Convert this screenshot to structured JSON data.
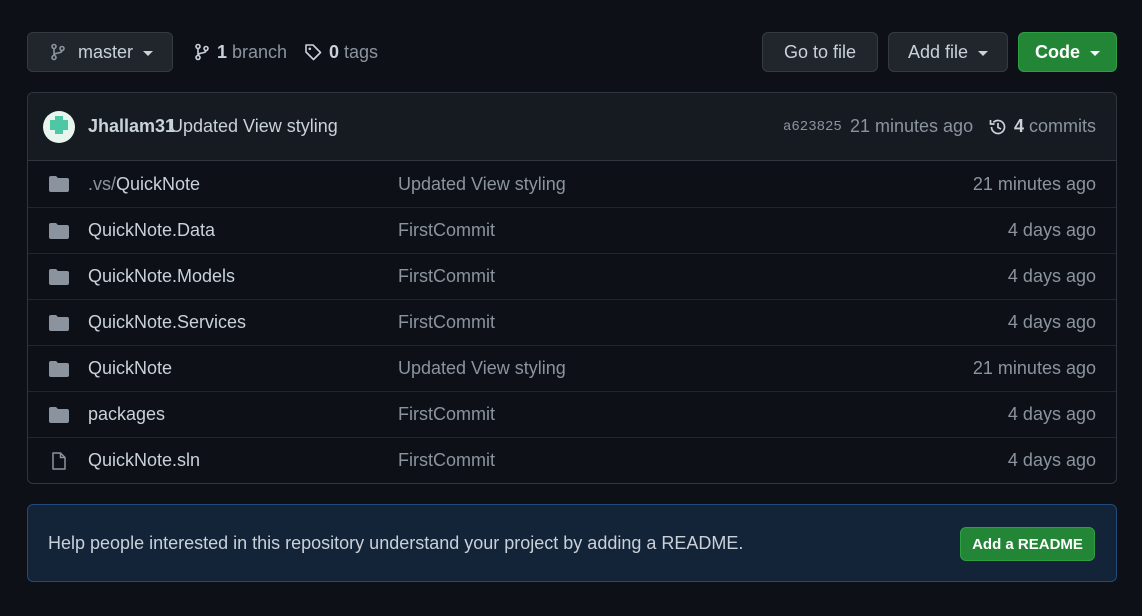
{
  "toolbar": {
    "branch_label": "master",
    "branches_count": "1",
    "branches_label": "branch",
    "tags_count": "0",
    "tags_label": "tags",
    "goto_label": "Go to file",
    "addfile_label": "Add file",
    "code_label": "Code"
  },
  "commit": {
    "author": "Jhallam31",
    "message": "Updated View styling",
    "sha": "a623825",
    "time": "21 minutes ago",
    "commits_count": "4",
    "commits_label": "commits"
  },
  "files": [
    {
      "prefix": ".vs/",
      "name": "QuickNote",
      "type": "folder",
      "message": "Updated View styling",
      "age": "21 minutes ago"
    },
    {
      "prefix": "",
      "name": "QuickNote.Data",
      "type": "folder",
      "message": "FirstCommit",
      "age": "4 days ago"
    },
    {
      "prefix": "",
      "name": "QuickNote.Models",
      "type": "folder",
      "message": "FirstCommit",
      "age": "4 days ago"
    },
    {
      "prefix": "",
      "name": "QuickNote.Services",
      "type": "folder",
      "message": "FirstCommit",
      "age": "4 days ago"
    },
    {
      "prefix": "",
      "name": "QuickNote",
      "type": "folder",
      "message": "Updated View styling",
      "age": "21 minutes ago"
    },
    {
      "prefix": "",
      "name": "packages",
      "type": "folder",
      "message": "FirstCommit",
      "age": "4 days ago"
    },
    {
      "prefix": "",
      "name": "QuickNote.sln",
      "type": "file",
      "message": "FirstCommit",
      "age": "4 days ago"
    }
  ],
  "readme": {
    "text": "Help people interested in this repository understand your project by adding a README.",
    "button_label": "Add a README"
  },
  "colors": {
    "background": "#0d1117",
    "accent_green": "#238636",
    "readme_bg": "#132338"
  }
}
